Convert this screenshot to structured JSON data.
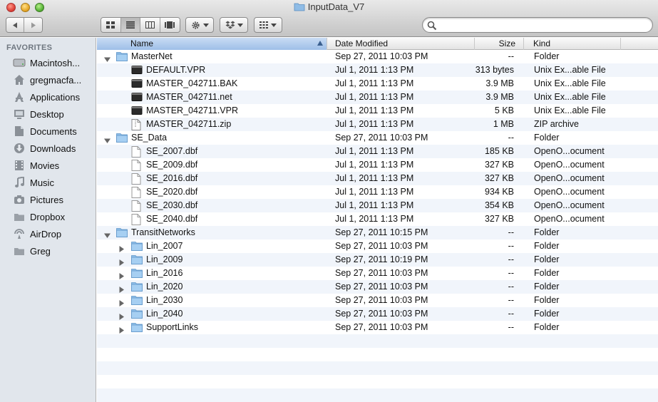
{
  "window": {
    "title": "InputData_V7"
  },
  "columns": {
    "name": "Name",
    "date": "Date Modified",
    "size": "Size",
    "kind": "Kind"
  },
  "sidebar": {
    "heading": "FAVORITES",
    "items": [
      {
        "label": "Macintosh...",
        "icon": "hard-drive-icon"
      },
      {
        "label": "gregmacfa...",
        "icon": "home-icon"
      },
      {
        "label": "Applications",
        "icon": "applications-icon"
      },
      {
        "label": "Desktop",
        "icon": "desktop-icon"
      },
      {
        "label": "Documents",
        "icon": "documents-icon"
      },
      {
        "label": "Downloads",
        "icon": "downloads-icon"
      },
      {
        "label": "Movies",
        "icon": "movies-icon"
      },
      {
        "label": "Music",
        "icon": "music-icon"
      },
      {
        "label": "Pictures",
        "icon": "pictures-icon"
      },
      {
        "label": "Dropbox",
        "icon": "folder-icon"
      },
      {
        "label": "AirDrop",
        "icon": "airdrop-icon"
      },
      {
        "label": "Greg",
        "icon": "folder-icon"
      }
    ]
  },
  "rows": [
    {
      "name": "MasterNet",
      "date": "Sep 27, 2011 10:03 PM",
      "size": "--",
      "kind": "Folder",
      "level": 0,
      "type": "folder",
      "expanded": true
    },
    {
      "name": "DEFAULT.VPR",
      "date": "Jul 1, 2011 1:13 PM",
      "size": "313 bytes",
      "kind": "Unix Ex...able File",
      "level": 1,
      "type": "exec"
    },
    {
      "name": "MASTER_042711.BAK",
      "date": "Jul 1, 2011 1:13 PM",
      "size": "3.9 MB",
      "kind": "Unix Ex...able File",
      "level": 1,
      "type": "exec"
    },
    {
      "name": "MASTER_042711.net",
      "date": "Jul 1, 2011 1:13 PM",
      "size": "3.9 MB",
      "kind": "Unix Ex...able File",
      "level": 1,
      "type": "exec"
    },
    {
      "name": "MASTER_042711.VPR",
      "date": "Jul 1, 2011 1:13 PM",
      "size": "5 KB",
      "kind": "Unix Ex...able File",
      "level": 1,
      "type": "exec"
    },
    {
      "name": "MASTER_042711.zip",
      "date": "Jul 1, 2011 1:13 PM",
      "size": "1 MB",
      "kind": "ZIP archive",
      "level": 1,
      "type": "zip"
    },
    {
      "name": "SE_Data",
      "date": "Sep 27, 2011 10:03 PM",
      "size": "--",
      "kind": "Folder",
      "level": 0,
      "type": "folder",
      "expanded": true
    },
    {
      "name": "SE_2007.dbf",
      "date": "Jul 1, 2011 1:13 PM",
      "size": "185 KB",
      "kind": "OpenO...ocument",
      "level": 1,
      "type": "doc"
    },
    {
      "name": "SE_2009.dbf",
      "date": "Jul 1, 2011 1:13 PM",
      "size": "327 KB",
      "kind": "OpenO...ocument",
      "level": 1,
      "type": "doc"
    },
    {
      "name": "SE_2016.dbf",
      "date": "Jul 1, 2011 1:13 PM",
      "size": "327 KB",
      "kind": "OpenO...ocument",
      "level": 1,
      "type": "doc"
    },
    {
      "name": "SE_2020.dbf",
      "date": "Jul 1, 2011 1:13 PM",
      "size": "934 KB",
      "kind": "OpenO...ocument",
      "level": 1,
      "type": "doc"
    },
    {
      "name": "SE_2030.dbf",
      "date": "Jul 1, 2011 1:13 PM",
      "size": "354 KB",
      "kind": "OpenO...ocument",
      "level": 1,
      "type": "doc"
    },
    {
      "name": "SE_2040.dbf",
      "date": "Jul 1, 2011 1:13 PM",
      "size": "327 KB",
      "kind": "OpenO...ocument",
      "level": 1,
      "type": "doc"
    },
    {
      "name": "TransitNetworks",
      "date": "Sep 27, 2011 10:15 PM",
      "size": "--",
      "kind": "Folder",
      "level": 0,
      "type": "folder",
      "expanded": true
    },
    {
      "name": "Lin_2007",
      "date": "Sep 27, 2011 10:03 PM",
      "size": "--",
      "kind": "Folder",
      "level": 1,
      "type": "folder",
      "expanded": false
    },
    {
      "name": "Lin_2009",
      "date": "Sep 27, 2011 10:19 PM",
      "size": "--",
      "kind": "Folder",
      "level": 1,
      "type": "folder",
      "expanded": false
    },
    {
      "name": "Lin_2016",
      "date": "Sep 27, 2011 10:03 PM",
      "size": "--",
      "kind": "Folder",
      "level": 1,
      "type": "folder",
      "expanded": false
    },
    {
      "name": "Lin_2020",
      "date": "Sep 27, 2011 10:03 PM",
      "size": "--",
      "kind": "Folder",
      "level": 1,
      "type": "folder",
      "expanded": false
    },
    {
      "name": "Lin_2030",
      "date": "Sep 27, 2011 10:03 PM",
      "size": "--",
      "kind": "Folder",
      "level": 1,
      "type": "folder",
      "expanded": false
    },
    {
      "name": "Lin_2040",
      "date": "Sep 27, 2011 10:03 PM",
      "size": "--",
      "kind": "Folder",
      "level": 1,
      "type": "folder",
      "expanded": false
    },
    {
      "name": "SupportLinks",
      "date": "Sep 27, 2011 10:03 PM",
      "size": "--",
      "kind": "Folder",
      "level": 1,
      "type": "folder",
      "expanded": false
    }
  ],
  "colors": {
    "selected_header": "#a9c6ec",
    "alt_row": "#f1f5fb",
    "folder_blue": "#7fb2e3",
    "sidebar_bg": "#e1e6ec"
  }
}
